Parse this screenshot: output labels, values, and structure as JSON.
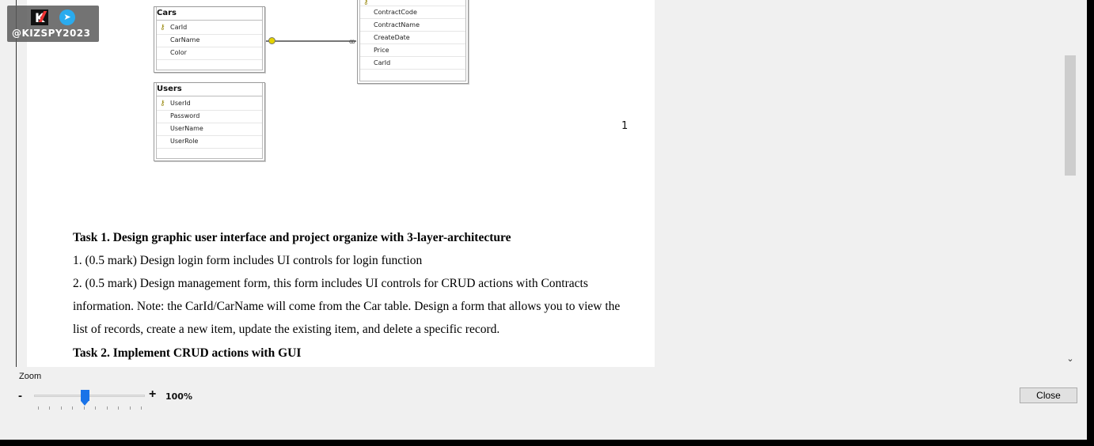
{
  "watermark": {
    "handle": "@KIZSPY2023",
    "logo_letter": "K"
  },
  "diagram": {
    "cars": {
      "title": "Cars",
      "columns": [
        "CarId",
        "CarName",
        "Color"
      ]
    },
    "contracts": {
      "columns": [
        "ContractCode",
        "ContractName",
        "CreateDate",
        "Price",
        "CarId"
      ]
    },
    "users": {
      "title": "Users",
      "columns": [
        "UserId",
        "Password",
        "UserName",
        "UserRole"
      ]
    }
  },
  "page_number": "1",
  "document": {
    "task1_heading": "Task 1. Design graphic user interface and project organize with 3-layer-architecture",
    "item1": "1. (0.5 mark) Design login form includes UI controls for login function",
    "item2_line1": "2. (0.5 mark) Design management form, this form includes UI controls for CRUD actions with Contracts",
    "item2_line2": "information. Note: the CarId/CarName will come from the Car table. Design a form that allows you to view the",
    "item2_line3": "list of records, create a new item, update the existing item, and delete a specific record.",
    "task2_heading": "Task 2. Implement CRUD actions with GUI"
  },
  "zoom": {
    "label": "Zoom",
    "minus": "-",
    "plus": "+",
    "value_text": "100%",
    "level_fraction": 0.46
  },
  "close_button": {
    "label": "Close"
  },
  "icons": {
    "scroll_down": "chevron-down-icon",
    "primary_key": "key-icon",
    "telegram": "telegram-icon"
  }
}
